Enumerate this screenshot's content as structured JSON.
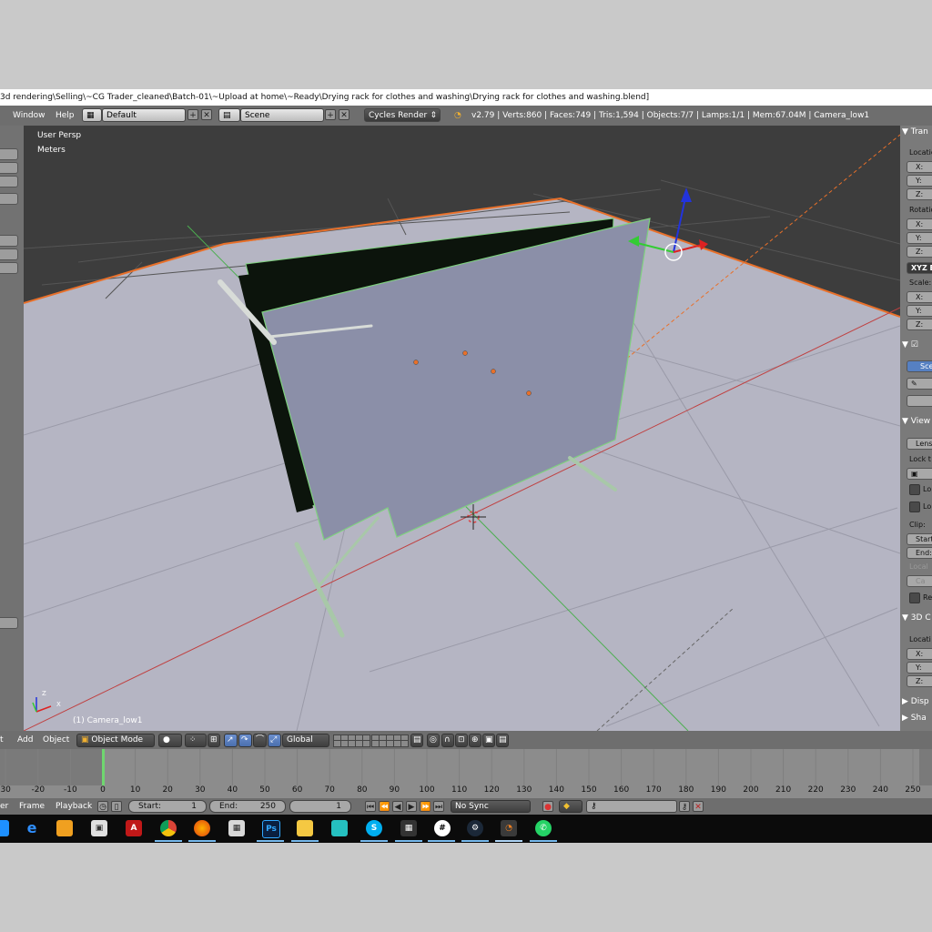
{
  "window": {
    "title": "3d rendering\\Selling\\~CG Trader_cleaned\\Batch-01\\~Upload at home\\~Ready\\Drying rack for clothes and washing\\Drying rack for clothes and washing.blend]"
  },
  "info_header": {
    "menus": [
      "Window",
      "Help"
    ],
    "screen_layout": "Default",
    "scene": "Scene",
    "render_engine": "Cycles Render",
    "stats": "v2.79 | Verts:860 | Faces:749 | Tris:1,594 | Objects:7/7 | Lamps:1/1 | Mem:67.04M | Camera_low1"
  },
  "viewport": {
    "view_name": "User Persp",
    "units": "Meters",
    "object_label": "(1) Camera_low1",
    "axis_x": "X",
    "axis_z": "Z"
  },
  "properties_panel": {
    "transform_header": "Tran",
    "location_label": "Locatio",
    "rotation_label": "Rotatio",
    "rotation_mode": "XYZ E",
    "scale_label": "Scale:",
    "x": "X:",
    "y": "Y:",
    "z": "Z:",
    "scene_button": "Sce",
    "view_header": "View",
    "lens_field": "Lens",
    "lock_label": "Lock t",
    "lock1": "Lo",
    "lock2": "Lo",
    "clip_label": "Clip:",
    "clip_start": "Start",
    "clip_end": "End:",
    "local_label": "Local",
    "camera_field": "Ca",
    "render_check": "Re",
    "cursor_header": "3D C",
    "cursor_location": "Locati",
    "display_header": "Disp",
    "shading_header": "Sha"
  },
  "view3d_header": {
    "menus": [
      "t",
      "Add",
      "Object"
    ],
    "mode": "Object Mode",
    "orientation": "Global"
  },
  "timeline": {
    "ticks": [
      "30",
      "-20",
      "-10",
      "0",
      "10",
      "20",
      "30",
      "40",
      "50",
      "60",
      "70",
      "80",
      "90",
      "100",
      "110",
      "120",
      "130",
      "140",
      "150",
      "160",
      "170",
      "180",
      "190",
      "200",
      "210",
      "220",
      "230",
      "240",
      "250"
    ],
    "current_frame_marker": "0"
  },
  "timeline_header": {
    "menus": [
      "er",
      "Frame",
      "Playback"
    ],
    "start": "Start:",
    "start_value": "1",
    "end": "End:",
    "end_value": "250",
    "current": "1",
    "sync": "No Sync"
  },
  "taskbar": {
    "apps": [
      "start-icon",
      "edge-icon",
      "photos-icon",
      "store-icon",
      "acrobat-icon",
      "chrome-icon",
      "firefox-icon",
      "calculator-icon",
      "photoshop-icon",
      "explorer-icon",
      "app-icon",
      "skype-icon",
      "app2-icon",
      "slack-icon",
      "steam-icon",
      "blender-icon",
      "whatsapp-icon"
    ],
    "photoshop_text": "Ps"
  },
  "colors": {
    "viewport_bg": "#3d3d3d",
    "ground": "#b6b6c4",
    "rack_panel": "#8b8fa8",
    "selection_orange": "#e8702a",
    "highlight_green": "#7fd17f"
  }
}
